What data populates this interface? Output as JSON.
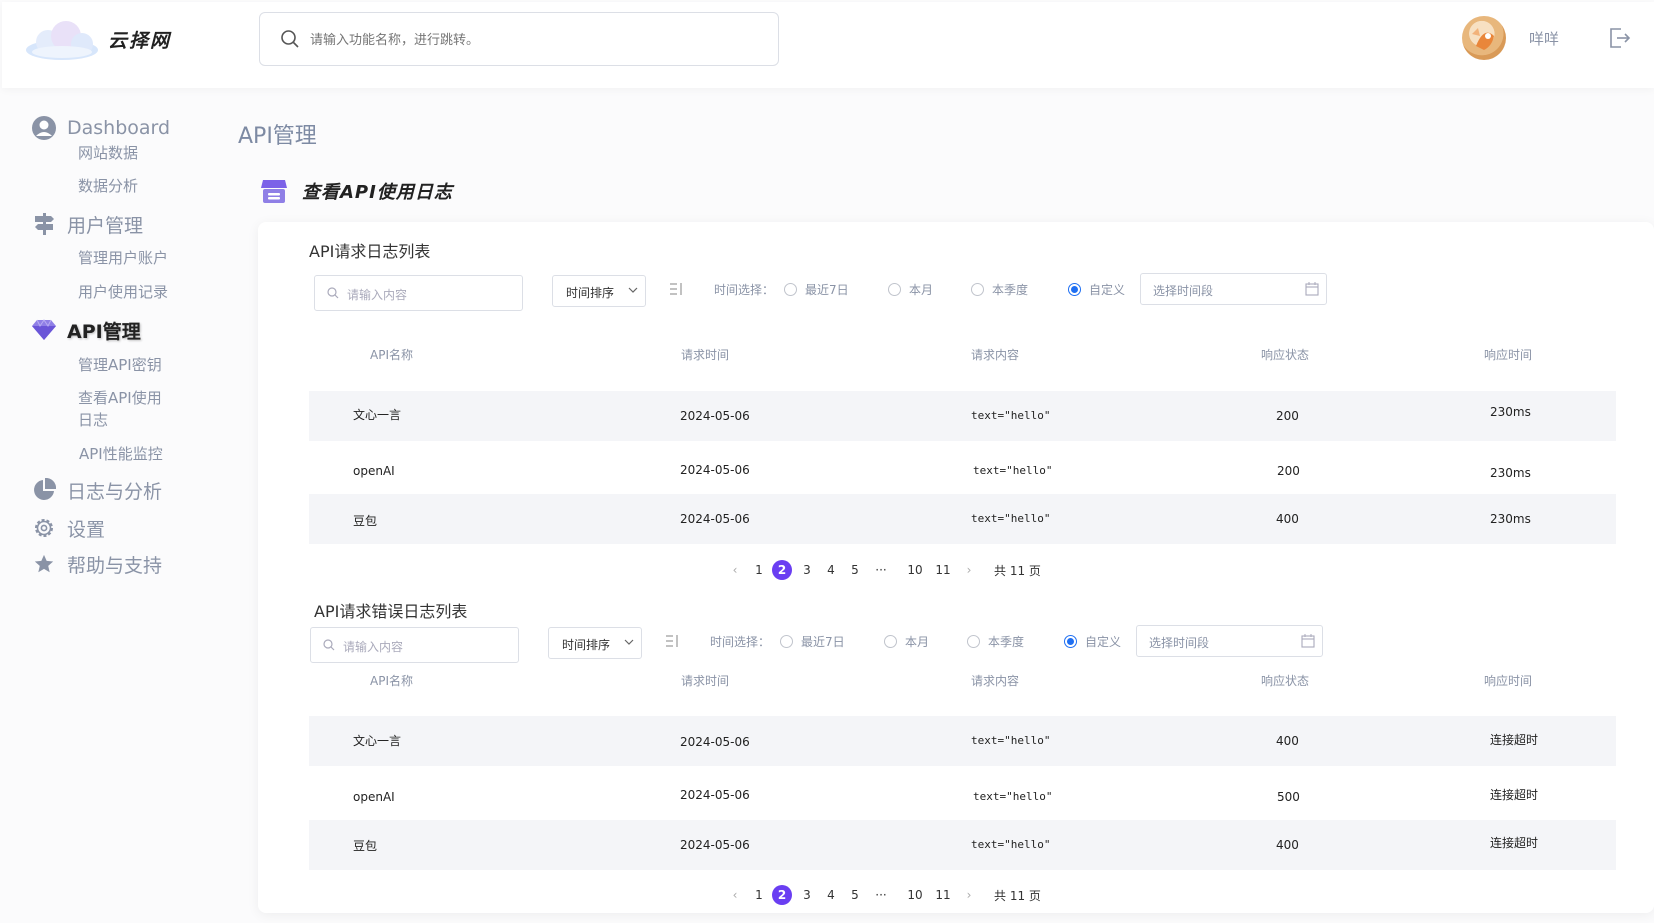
{
  "header": {
    "brand": "云择网",
    "search_placeholder": "请输入功能名称，进行跳转。",
    "username": "咩咩"
  },
  "sidebar": {
    "groups": [
      {
        "label": "Dashboard",
        "icon": "user-circle-icon",
        "items": [
          "网站数据",
          "数据分析"
        ]
      },
      {
        "label": "用户管理",
        "icon": "signpost-icon",
        "items": [
          "管理用户账户",
          "用户使用记录"
        ]
      },
      {
        "label": "API管理",
        "icon": "gem-icon",
        "active": true,
        "items": [
          "管理API密钥",
          "查看API使用",
          "日志",
          "API性能监控"
        ]
      },
      {
        "label": "日志与分析",
        "icon": "pie-chart-icon",
        "items": []
      },
      {
        "label": "设置",
        "icon": "gear-icon",
        "items": []
      },
      {
        "label": "帮助与支持",
        "icon": "star-icon",
        "items": []
      }
    ]
  },
  "main": {
    "page_title": "API管理",
    "section_title": "查看API使用日志",
    "filter": {
      "search_placeholder": "请输入内容",
      "sort_label": "时间排序",
      "time_label": "时间选择：",
      "options": [
        "最近7日",
        "本月",
        "本季度",
        "自定义"
      ],
      "selected": "自定义",
      "range_placeholder": "选择时间段"
    },
    "columns": [
      "API名称",
      "请求时间",
      "请求内容",
      "响应状态",
      "响应时间"
    ],
    "request_log": {
      "title": "API请求日志列表",
      "rows": [
        {
          "name": "文心一言",
          "time": "2024-05-06",
          "content": "text=\"hello\"",
          "status": "200",
          "resp": "230ms"
        },
        {
          "name": "openAI",
          "time": "2024-05-06",
          "content": "text=\"hello\"",
          "status": "200",
          "resp": "230ms"
        },
        {
          "name": "豆包",
          "time": "2024-05-06",
          "content": "text=\"hello\"",
          "status": "400",
          "resp": "230ms"
        }
      ]
    },
    "error_log": {
      "title": "API请求错误日志列表",
      "rows": [
        {
          "name": "文心一言",
          "time": "2024-05-06",
          "content": "text=\"hello\"",
          "status": "400",
          "resp": "连接超时"
        },
        {
          "name": "openAI",
          "time": "2024-05-06",
          "content": "text=\"hello\"",
          "status": "500",
          "resp": "连接超时"
        },
        {
          "name": "豆包",
          "time": "2024-05-06",
          "content": "text=\"hello\"",
          "status": "400",
          "resp": "连接超时"
        }
      ]
    },
    "pagination": {
      "pages": [
        "1",
        "2",
        "3",
        "4",
        "5",
        "···",
        "10",
        "11"
      ],
      "current": "2",
      "total": "共 11 页"
    }
  },
  "colors": {
    "accent": "#6a3ef2",
    "radio": "#1f6ff2",
    "muted": "#8a93a6"
  }
}
